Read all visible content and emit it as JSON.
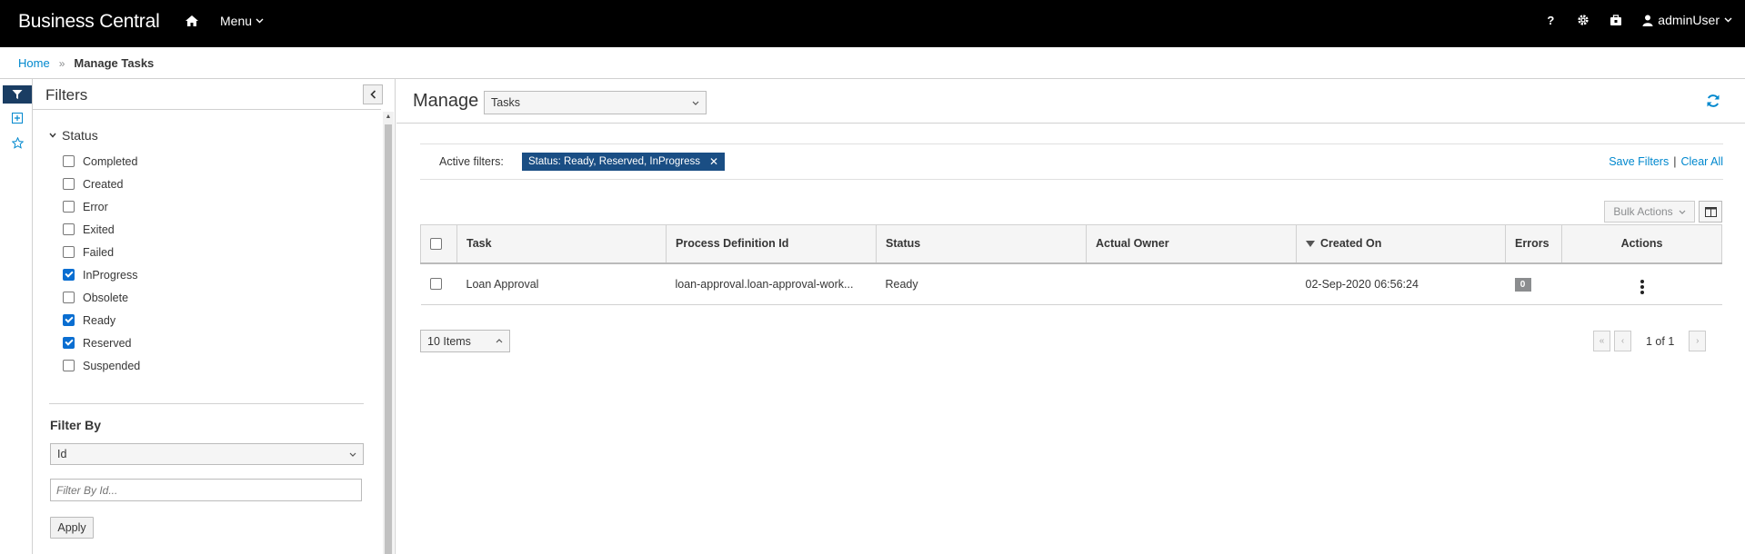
{
  "topbar": {
    "brand": "Business Central",
    "menu_label": "Menu",
    "help_icon": "?",
    "user_label": "adminUser"
  },
  "breadcrumb": {
    "home": "Home",
    "separator": "»",
    "current": "Manage Tasks"
  },
  "filters": {
    "title": "Filters",
    "status_group": {
      "title": "Status",
      "options": [
        {
          "label": "Completed",
          "checked": false
        },
        {
          "label": "Created",
          "checked": false
        },
        {
          "label": "Error",
          "checked": false
        },
        {
          "label": "Exited",
          "checked": false
        },
        {
          "label": "Failed",
          "checked": false
        },
        {
          "label": "InProgress",
          "checked": true
        },
        {
          "label": "Obsolete",
          "checked": false
        },
        {
          "label": "Ready",
          "checked": true
        },
        {
          "label": "Reserved",
          "checked": true
        },
        {
          "label": "Suspended",
          "checked": false
        }
      ]
    },
    "filter_by": {
      "label": "Filter By",
      "selected": "Id",
      "placeholder": "Filter By Id...",
      "apply_label": "Apply"
    }
  },
  "main": {
    "manage_label": "Manage",
    "view_selected": "Tasks",
    "active_filters": {
      "label": "Active filters:",
      "chip": "Status: Ready, Reserved, InProgress",
      "save_label": "Save Filters",
      "divider": "|",
      "clear_label": "Clear All"
    },
    "bulk_actions_label": "Bulk Actions",
    "table": {
      "columns": [
        "Task",
        "Process Definition Id",
        "Status",
        "Actual Owner",
        "Created On",
        "Errors",
        "Actions"
      ],
      "rows": [
        {
          "task": "Loan Approval",
          "process_definition_id": "loan-approval.loan-approval-work...",
          "status": "Ready",
          "actual_owner": "",
          "created_on": "02-Sep-2020 06:56:24",
          "errors": "0"
        }
      ]
    },
    "page_size_label": "10 Items",
    "pagination": "1 of 1"
  },
  "colors": {
    "topbar_bg": "#000000",
    "link": "#0088ce",
    "chip_bg": "#1a4e84",
    "rail_active": "#1a3d63"
  }
}
